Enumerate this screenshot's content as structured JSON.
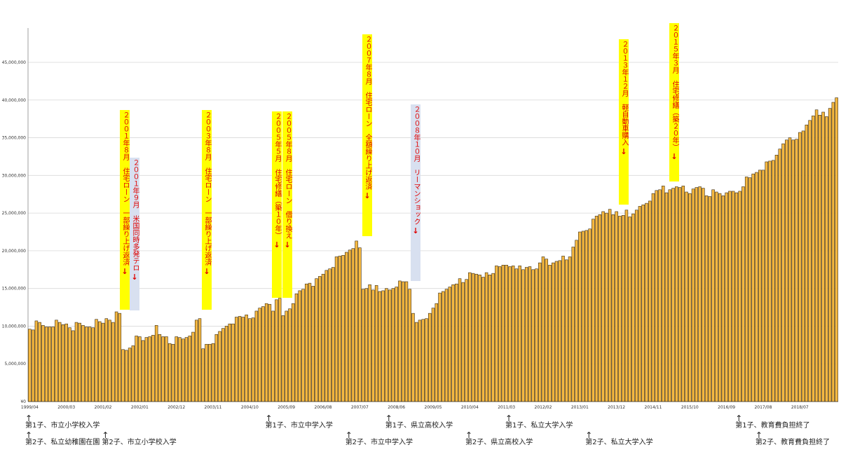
{
  "chart_data": {
    "type": "bar",
    "title": "",
    "xlabel": "",
    "ylabel": "",
    "ylim": [
      0,
      45000000
    ],
    "yticks": [
      {
        "v": 0,
        "label": "¥0"
      },
      {
        "v": 5000000,
        "label": "5,000,000"
      },
      {
        "v": 10000000,
        "label": "10,000,000"
      },
      {
        "v": 15000000,
        "label": "15,000,000"
      },
      {
        "v": 20000000,
        "label": "20,000,000"
      },
      {
        "v": 25000000,
        "label": "25,000,000"
      },
      {
        "v": 30000000,
        "label": "30,000,000"
      },
      {
        "v": 35000000,
        "label": "35,000,000"
      },
      {
        "v": 40000000,
        "label": "40,000,000"
      },
      {
        "v": 45000000,
        "label": "45,000,000"
      }
    ],
    "grid": true,
    "bar_color": "#f5b840",
    "bar_edge_color": "#3a2a10",
    "start": "1999/04",
    "interval_months": 2,
    "xtick_labels": [
      {
        "i": 0,
        "label": "1999/04"
      },
      {
        "i": 11,
        "label": "2000/03"
      },
      {
        "i": 22,
        "label": "2001/02"
      },
      {
        "i": 33,
        "label": "2002/01"
      },
      {
        "i": 44,
        "label": "2002/12"
      },
      {
        "i": 55,
        "label": "2003/11"
      },
      {
        "i": 66,
        "label": "2004/10"
      },
      {
        "i": 77,
        "label": "2005/09"
      },
      {
        "i": 88,
        "label": "2006/08"
      },
      {
        "i": 99,
        "label": "2007/07"
      },
      {
        "i": 110,
        "label": "2008/06"
      },
      {
        "i": 121,
        "label": "2009/05"
      },
      {
        "i": 132,
        "label": "2010/04"
      },
      {
        "i": 143,
        "label": "2011/03"
      },
      {
        "i": 154,
        "label": "2012/02"
      },
      {
        "i": 165,
        "label": "2013/01"
      },
      {
        "i": 176,
        "label": "2013/12"
      },
      {
        "i": 187,
        "label": "2014/11"
      },
      {
        "i": 198,
        "label": "2015/10"
      },
      {
        "i": 209,
        "label": "2016/09"
      },
      {
        "i": 220,
        "label": "2017/08"
      },
      {
        "i": 231,
        "label": "2018/07"
      }
    ],
    "values": [
      9600000,
      9500000,
      10700000,
      10500000,
      10100000,
      9900000,
      9900000,
      9900000,
      10800000,
      10500000,
      10200000,
      10300000,
      9800000,
      9400000,
      10500000,
      10400000,
      10100000,
      9900000,
      9900000,
      9800000,
      10900000,
      10600000,
      10400000,
      11000000,
      10800000,
      10500000,
      11900000,
      11700000,
      6900000,
      6800000,
      7100000,
      7400000,
      8700000,
      8600000,
      8100000,
      8500000,
      8600000,
      8800000,
      10100000,
      8900000,
      8600000,
      8600000,
      7700000,
      7600000,
      8600000,
      8500000,
      8300000,
      8500000,
      8700000,
      9200000,
      10800000,
      11000000,
      7000000,
      7600000,
      7600000,
      7700000,
      8900000,
      9300000,
      9700000,
      10000000,
      10300000,
      10300000,
      11200000,
      11300000,
      11200000,
      11500000,
      11000000,
      11100000,
      12000000,
      12400000,
      12600000,
      13000000,
      12900000,
      12000000,
      13500000,
      13700000,
      11400000,
      12000000,
      12300000,
      13000000,
      14300000,
      14700000,
      14900000,
      15600000,
      15700000,
      15300000,
      16300000,
      16600000,
      16900000,
      17400000,
      17600000,
      17800000,
      19200000,
      19300000,
      19400000,
      19800000,
      20100000,
      20300000,
      21300000,
      20400000,
      14900000,
      15000000,
      15500000,
      14800000,
      15400000,
      14600000,
      14700000,
      15000000,
      14800000,
      15000000,
      15200000,
      16000000,
      15900000,
      15900000,
      14900000,
      11700000,
      10500000,
      10800000,
      10900000,
      11000000,
      11700000,
      12400000,
      13000000,
      14400000,
      14600000,
      14900000,
      15200000,
      15500000,
      15600000,
      16300000,
      15800000,
      16200000,
      17100000,
      17000000,
      16900000,
      16800000,
      16500000,
      17100000,
      16800000,
      17000000,
      18000000,
      17900000,
      18100000,
      18100000,
      17900000,
      18000000,
      17600000,
      18000000,
      17500000,
      17800000,
      17900000,
      17500000,
      17600000,
      18400000,
      19200000,
      18900000,
      18100000,
      18400000,
      18600000,
      18700000,
      19300000,
      18800000,
      19200000,
      20500000,
      21400000,
      22500000,
      22600000,
      22700000,
      22900000,
      24200000,
      24600000,
      24800000,
      25200000,
      25000000,
      25500000,
      24800000,
      25200000,
      24600000,
      24700000,
      25400000,
      24500000,
      24900000,
      25400000,
      25900000,
      26100000,
      26300000,
      26600000,
      27600000,
      28000000,
      28100000,
      28600000,
      27700000,
      28100000,
      28300000,
      28500000,
      28400000,
      28600000,
      27800000,
      27600000,
      28200000,
      28400000,
      28500000,
      28300000,
      27300000,
      27200000,
      28100000,
      27800000,
      27600000,
      27300000,
      27700000,
      27900000,
      27900000,
      27700000,
      27900000,
      28500000,
      29800000,
      29700000,
      30200000,
      30400000,
      30700000,
      30700000,
      31800000,
      31900000,
      32000000,
      32700000,
      33500000,
      34200000,
      34700000,
      35000000,
      34700000,
      34800000,
      35700000,
      35900000,
      36700000,
      37300000,
      37900000,
      38700000,
      38000000,
      38400000,
      37800000,
      38900000,
      39700000,
      40300000
    ]
  },
  "events_bottom": [
    {
      "i": 0,
      "row": 1,
      "text": "第1子、市立小学校入学"
    },
    {
      "i": 0,
      "row": 2,
      "text": "第2子、私立幼稚園在園"
    },
    {
      "i": 23,
      "row": 2,
      "text": "第2子、市立小学校入学"
    },
    {
      "i": 72,
      "row": 1,
      "text": "第1子、市立中学入学"
    },
    {
      "i": 96,
      "row": 2,
      "text": "第2子、市立中学入学"
    },
    {
      "i": 108,
      "row": 1,
      "text": "第1子、県立高校入学"
    },
    {
      "i": 132,
      "row": 2,
      "text": "第2子、県立高校入学"
    },
    {
      "i": 144,
      "row": 1,
      "text": "第1子、私立大学入学"
    },
    {
      "i": 168,
      "row": 2,
      "text": "第2子、私立大学入学"
    },
    {
      "i": 213,
      "row": 1,
      "text": "第1子、教育費負担終了"
    },
    {
      "i": 219,
      "row": 2,
      "text": "第2子、教育費負担終了"
    }
  ],
  "events_top": [
    {
      "id": "e1",
      "text": "２００１年８月　住宅ローン　一部繰り上げ返済",
      "bg": "#ffff00"
    },
    {
      "id": "e2",
      "text": "２００１年９月　米国同時多発テロ",
      "bg": "#d8e0f0"
    },
    {
      "id": "e3",
      "text": "２００３年８月　住宅ローン　一部繰り上げ返済",
      "bg": "#ffff00"
    },
    {
      "id": "e4",
      "text": "２００５年５月　住宅修繕（築１０年）",
      "bg": "#ffff00"
    },
    {
      "id": "e5",
      "text": "２００５年８月　住宅ローン　借り換え",
      "bg": "#ffff00"
    },
    {
      "id": "e6",
      "text": "２００７年８月　住宅ローン　全額繰り上げ返済",
      "bg": "#ffff00"
    },
    {
      "id": "e7",
      "text": "２００８年１０月　リーマンショック",
      "bg": "#d8e0f0"
    },
    {
      "id": "e8",
      "text": "２０１３年１２月　軽自動車購入",
      "bg": "#ffff00"
    },
    {
      "id": "e9",
      "text": "２０１５年３月　住宅修繕（築２０年）",
      "bg": "#ffff00"
    }
  ],
  "arrow_down": "↓",
  "arrow_up": "↑"
}
